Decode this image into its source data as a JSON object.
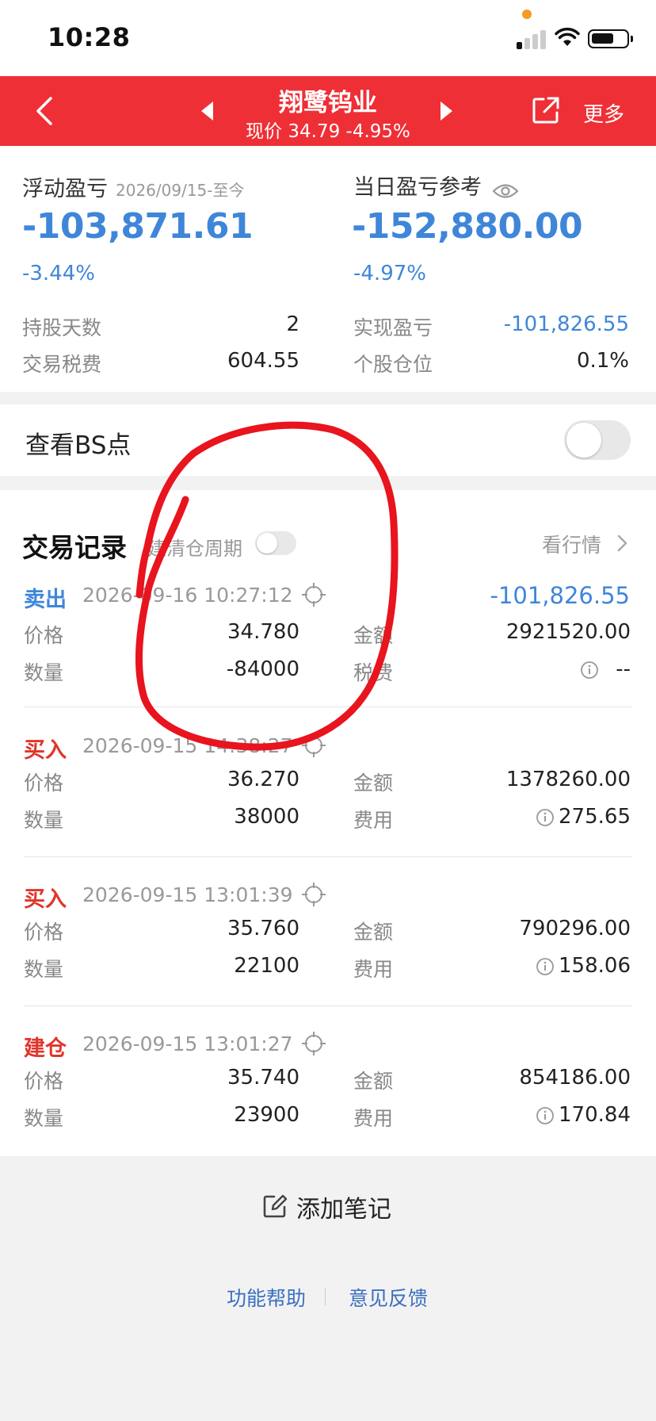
{
  "status_bar": {
    "time": "10:28"
  },
  "header": {
    "title": "翔鹭钨业",
    "subtitle": "现价 34.79 -4.95%",
    "more_label": "更多"
  },
  "summary": {
    "floating": {
      "label": "浮动盈亏",
      "date_range": "2026/09/15-至今",
      "value": "-103,871.61",
      "percent": "-3.44%"
    },
    "daily": {
      "label": "当日盈亏参考",
      "value": "-152,880.00",
      "percent": "-4.97%"
    },
    "stats": {
      "hold_days_label": "持股天数",
      "hold_days_value": "2",
      "tax_label": "交易税费",
      "tax_value": "604.55",
      "realized_label": "实现盈亏",
      "realized_value": "-101,826.55",
      "position_label": "个股仓位",
      "position_value": "0.1%"
    }
  },
  "bs": {
    "label": "查看BS点",
    "enabled": false
  },
  "trades": {
    "title": "交易记录",
    "cycle_label": "建清仓周期",
    "view_quote_label": "看行情",
    "items": [
      {
        "type": "卖出",
        "kind": "sell",
        "time": "2026-09-16 10:27:12",
        "pnl": "-101,826.55",
        "price_label": "价格",
        "price": "34.780",
        "qty_label": "数量",
        "qty": "-84000",
        "amount_label": "金额",
        "amount": "2921520.00",
        "fee_label": "税费",
        "fee": "--"
      },
      {
        "type": "买入",
        "kind": "buy",
        "time": "2026-09-15 14:38:27",
        "pnl": "",
        "price_label": "价格",
        "price": "36.270",
        "qty_label": "数量",
        "qty": "38000",
        "amount_label": "金额",
        "amount": "1378260.00",
        "fee_label": "费用",
        "fee": "275.65"
      },
      {
        "type": "买入",
        "kind": "buy",
        "time": "2026-09-15 13:01:39",
        "pnl": "",
        "price_label": "价格",
        "price": "35.760",
        "qty_label": "数量",
        "qty": "22100",
        "amount_label": "金额",
        "amount": "790296.00",
        "fee_label": "费用",
        "fee": "158.06"
      },
      {
        "type": "建仓",
        "kind": "buy",
        "time": "2026-09-15 13:01:27",
        "pnl": "",
        "price_label": "价格",
        "price": "35.740",
        "qty_label": "数量",
        "qty": "23900",
        "amount_label": "金额",
        "amount": "854186.00",
        "fee_label": "费用",
        "fee": "170.84"
      }
    ]
  },
  "footer": {
    "add_note_label": "添加笔记",
    "help_label": "功能帮助",
    "feedback_label": "意见反馈"
  },
  "colors": {
    "header_red": "#ef2f36",
    "loss_blue": "#3f86d9",
    "buy_red": "#e0352b",
    "annotation_red": "#e8141e"
  },
  "icons": [
    "back-arrow-icon",
    "prev-stock-icon",
    "next-stock-icon",
    "share-icon",
    "eye-icon",
    "target-icon",
    "info-icon",
    "chevron-right-icon",
    "edit-note-icon"
  ]
}
